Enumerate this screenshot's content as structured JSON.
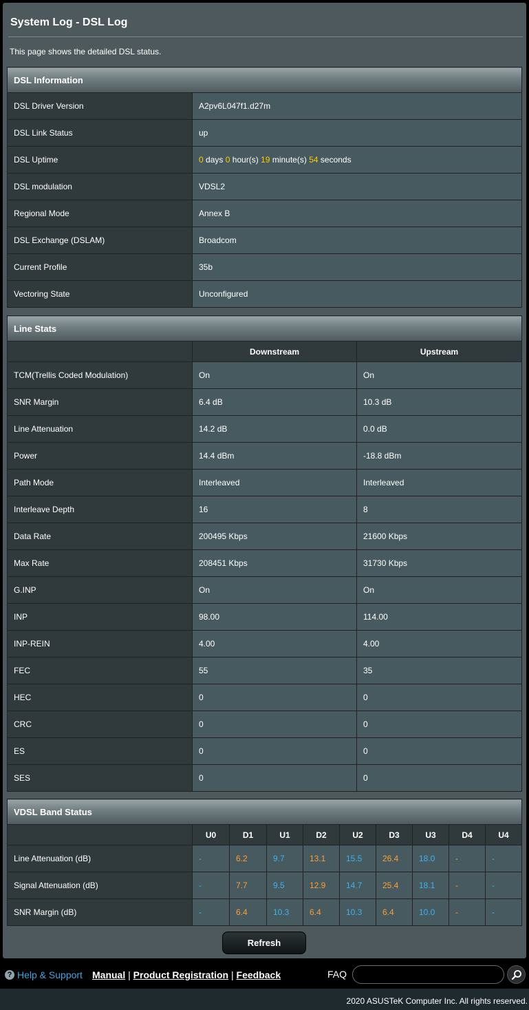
{
  "page": {
    "title": "System Log - DSL Log",
    "description": "This page shows the detailed DSL status."
  },
  "dsl_info": {
    "header": "DSL Information",
    "driver_version_label": "DSL Driver Version",
    "driver_version": "A2pv6L047f1.d27m",
    "link_status_label": "DSL Link Status",
    "link_status": "up",
    "uptime_label": "DSL Uptime",
    "uptime": {
      "days": "0",
      "days_unit": "days",
      "hours": "0",
      "hours_unit": "hour(s)",
      "minutes": "19",
      "minutes_unit": "minute(s)",
      "seconds": "54",
      "seconds_unit": "seconds"
    },
    "modulation_label": "DSL modulation",
    "modulation": "VDSL2",
    "regional_mode_label": "Regional Mode",
    "regional_mode": "Annex B",
    "exchange_label": "DSL Exchange (DSLAM)",
    "exchange": "Broadcom",
    "profile_label": "Current Profile",
    "profile": "35b",
    "vectoring_label": "Vectoring State",
    "vectoring": "Unconfigured"
  },
  "line_stats": {
    "header": "Line Stats",
    "col_downstream": "Downstream",
    "col_upstream": "Upstream",
    "rows": [
      {
        "label": "TCM(Trellis Coded Modulation)",
        "down": "On",
        "up": "On"
      },
      {
        "label": "SNR Margin",
        "down": "6.4 dB",
        "up": "10.3 dB"
      },
      {
        "label": "Line Attenuation",
        "down": "14.2 dB",
        "up": "0.0 dB"
      },
      {
        "label": "Power",
        "down": "14.4 dBm",
        "up": "-18.8 dBm"
      },
      {
        "label": "Path Mode",
        "down": "Interleaved",
        "up": "Interleaved"
      },
      {
        "label": "Interleave Depth",
        "down": "16",
        "up": "8"
      },
      {
        "label": "Data Rate",
        "down": "200495 Kbps",
        "up": "21600 Kbps"
      },
      {
        "label": "Max Rate",
        "down": "208451 Kbps",
        "up": "31730 Kbps"
      },
      {
        "label": "G.INP",
        "down": "On",
        "up": "On"
      },
      {
        "label": "INP",
        "down": "98.00",
        "up": "114.00"
      },
      {
        "label": "INP-REIN",
        "down": "4.00",
        "up": "4.00"
      },
      {
        "label": "FEC",
        "down": "55",
        "up": "35"
      },
      {
        "label": "HEC",
        "down": "0",
        "up": "0"
      },
      {
        "label": "CRC",
        "down": "0",
        "up": "0"
      },
      {
        "label": "ES",
        "down": "0",
        "up": "0"
      },
      {
        "label": "SES",
        "down": "0",
        "up": "0"
      }
    ]
  },
  "band_status": {
    "header": "VDSL Band Status",
    "bands": [
      "U0",
      "D1",
      "U1",
      "D2",
      "U2",
      "D3",
      "U3",
      "D4",
      "U4"
    ],
    "rows": [
      {
        "label": "Line Attenuation (dB)",
        "values": [
          "-",
          "6.2",
          "9.7",
          "13.1",
          "15.5",
          "26.4",
          "18.0",
          "-",
          "-"
        ]
      },
      {
        "label": "Signal Attenuation (dB)",
        "values": [
          "-",
          "7.7",
          "9.5",
          "12.9",
          "14.7",
          "25.4",
          "18.1",
          "-",
          "-"
        ]
      },
      {
        "label": "SNR Margin (dB)",
        "values": [
          "-",
          "6.4",
          "10.3",
          "6.4",
          "10.3",
          "6.4",
          "10.0",
          "-",
          "-"
        ]
      }
    ]
  },
  "buttons": {
    "refresh": "Refresh"
  },
  "footer": {
    "help_icon": "?",
    "help_support": "Help & Support",
    "manual": "Manual",
    "sep1": "|",
    "product_registration": "Product Registration",
    "sep2": "|",
    "feedback": "Feedback",
    "faq": "FAQ",
    "faq_placeholder": "",
    "copyright": "2020 ASUSTeK Computer Inc. All rights reserved."
  },
  "colors": {
    "panel": "#4d595d",
    "label_cell": "#30393b",
    "value_cell": "#475a5f",
    "downstream_band": "#fc9d37",
    "upstream_band": "#3fb1ef",
    "uptime_number": "#ffcc00",
    "help_link": "#3aa7e0"
  }
}
